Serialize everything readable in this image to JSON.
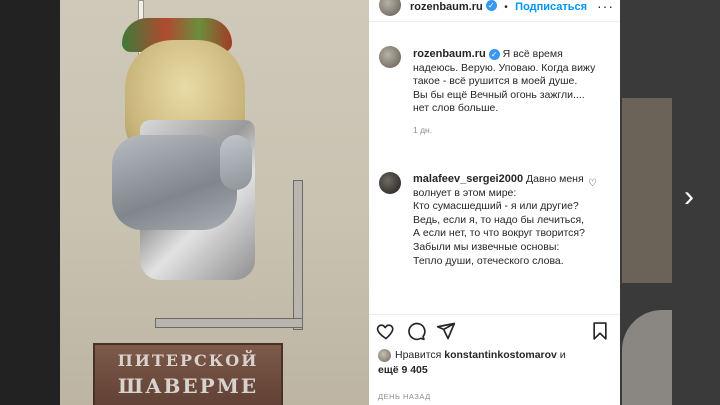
{
  "post": {
    "author": "rozenbaum.ru",
    "follow_label": "Подписаться",
    "separator": "•",
    "more_glyph": "···",
    "photo_sign": {
      "line1": "ПИТЕРСКОЙ",
      "line2": "ШАВЕРМЕ"
    }
  },
  "caption": {
    "author": "rozenbaum.ru",
    "lines": [
      "Я всё время надеюсь. Верую. Уповаю. Когда вижу такое - всё рушится в моей душе.",
      "Вы бы ещё Вечный огонь зажгли.... нет слов больше."
    ],
    "time": "1 дн."
  },
  "comment": {
    "author": "malafeev_sergei2000",
    "lines": [
      "Давно меня волнует в этом мире:",
      "Кто сумасшедший - я или другие?",
      "Ведь, если я, то надо бы лечиться,",
      "А если нет, то что вокруг творится?",
      "Забыли мы извечные основы:",
      "Тепло души, отеческого слова."
    ]
  },
  "likes": {
    "prefix": "Нравится",
    "user": "konstantinkostomarov",
    "connector": "и",
    "others": "ещё 9 405"
  },
  "timestamp": "ДЕНЬ НАЗАД",
  "icons": {
    "verified": "verified-badge-icon",
    "like": "heart-icon",
    "comment": "comment-bubble-icon",
    "share": "paper-plane-icon",
    "save": "bookmark-icon",
    "next": "chevron-right-icon"
  },
  "colors": {
    "link": "#0095f6",
    "verified": "#3897f0",
    "muted": "#8e8e8e",
    "text": "#262626"
  }
}
